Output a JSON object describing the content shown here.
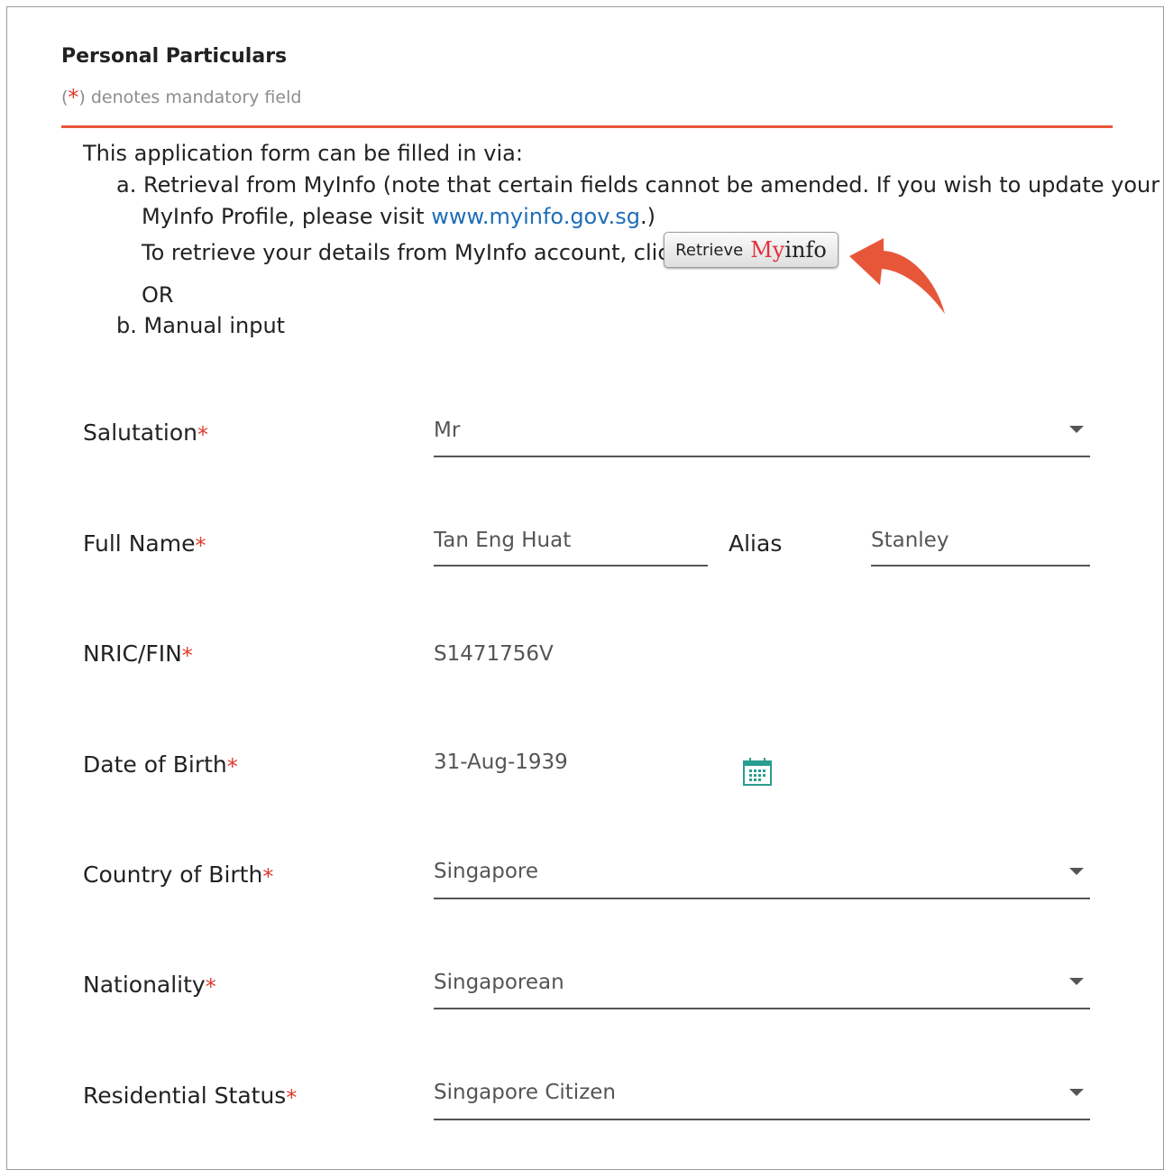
{
  "section": {
    "title": "Personal Particulars",
    "mandatory_open": "(",
    "mandatory_star": "*",
    "mandatory_text": ") denotes mandatory field"
  },
  "intro": {
    "line1": "This application form can be filled in via:",
    "a_line1": "a. Retrieval from MyInfo (note that certain fields cannot be amended. If you wish to update your",
    "a_line2_pre": "MyInfo Profile, please visit ",
    "a_link": "www.myinfo.gov.sg",
    "a_line2_post": ".)",
    "retrieve_text": "To retrieve your details from MyInfo account, click",
    "or": "OR",
    "b_line": "b. Manual input"
  },
  "myinfo_button": {
    "retrieve": "Retrieve",
    "my": "My",
    "info": "info"
  },
  "colors": {
    "accent": "#e8563a",
    "link": "#1f6db8",
    "asterisk": "#e03a2b",
    "calendar": "#2a9d8f"
  },
  "fields": {
    "salutation": {
      "label": "Salutation",
      "value": "Mr"
    },
    "full_name": {
      "label": "Full Name",
      "value": "Tan Eng Huat"
    },
    "alias": {
      "label": "Alias",
      "value": "Stanley"
    },
    "nric": {
      "label": "NRIC/FIN",
      "value": "S1471756V"
    },
    "dob": {
      "label": "Date of Birth",
      "value": "31-Aug-1939"
    },
    "country_of_birth": {
      "label": "Country of Birth",
      "value": "Singapore"
    },
    "nationality": {
      "label": "Nationality",
      "value": "Singaporean"
    },
    "residential_status": {
      "label": "Residential Status",
      "value": "Singapore Citizen"
    }
  },
  "asterisk": "*",
  "icons": {
    "dropdown": "caret-down-icon",
    "calendar": "calendar-icon",
    "pointer": "curved-arrow-icon"
  }
}
